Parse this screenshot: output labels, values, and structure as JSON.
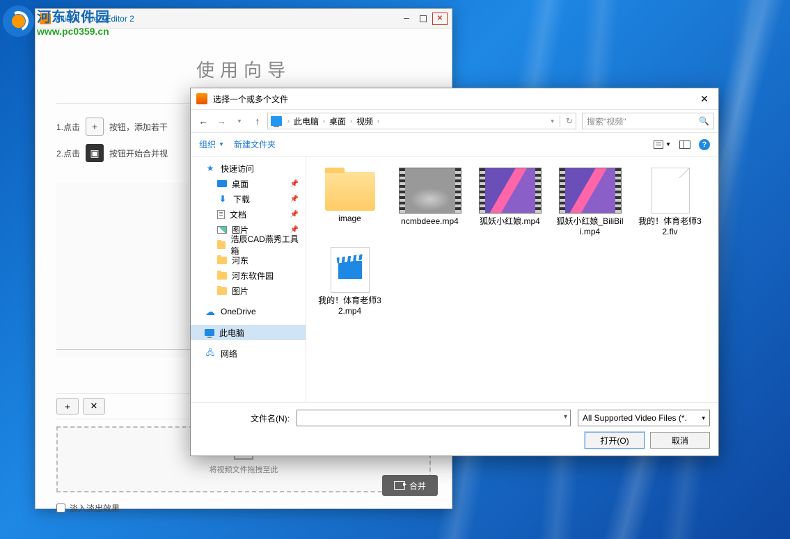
{
  "watermark": {
    "cn": "河东软件园",
    "url": "www.pc0359.cn"
  },
  "editor": {
    "title": "Xilisoft Video Editor 2",
    "wizard_title": "使用向导",
    "step1_prefix": "1.点击",
    "step1_suffix": "按钮，添加若干",
    "step2_prefix": "2.点击",
    "step2_suffix": "按钮开始合并视",
    "dropzone_text": "将视频文件拖拽至此",
    "fade_label": "淡入淡出效果",
    "merge_label": "合并"
  },
  "dialog": {
    "title": "选择一个或多个文件",
    "breadcrumb": [
      "此电脑",
      "桌面",
      "视频"
    ],
    "search_placeholder": "搜索\"视频\"",
    "organize": "组织",
    "new_folder": "新建文件夹",
    "sidebar": {
      "quick_access": "快速访问",
      "desktop": "桌面",
      "downloads": "下载",
      "documents": "文档",
      "pictures": "图片",
      "folders": [
        "浩辰CAD燕秀工具箱",
        "河东",
        "河东软件园",
        "图片"
      ],
      "onedrive": "OneDrive",
      "this_pc": "此电脑",
      "network": "网络"
    },
    "files": [
      {
        "name": "image",
        "kind": "folder"
      },
      {
        "name": "ncmbdeee.mp4",
        "kind": "video-car"
      },
      {
        "name": "狐妖小红娘.mp4",
        "kind": "video-anime"
      },
      {
        "name": "狐妖小红娘_BiliBili.mp4",
        "kind": "video-anime"
      },
      {
        "name": "我的！体育老师32.flv",
        "kind": "doc-generic"
      },
      {
        "name": "我的！体育老师32.mp4",
        "kind": "mp4-generic"
      }
    ],
    "filename_label": "文件名(N):",
    "filename_value": "",
    "filter": "All Supported Video Files (*.",
    "open_btn": "打开(O)",
    "cancel_btn": "取消"
  }
}
